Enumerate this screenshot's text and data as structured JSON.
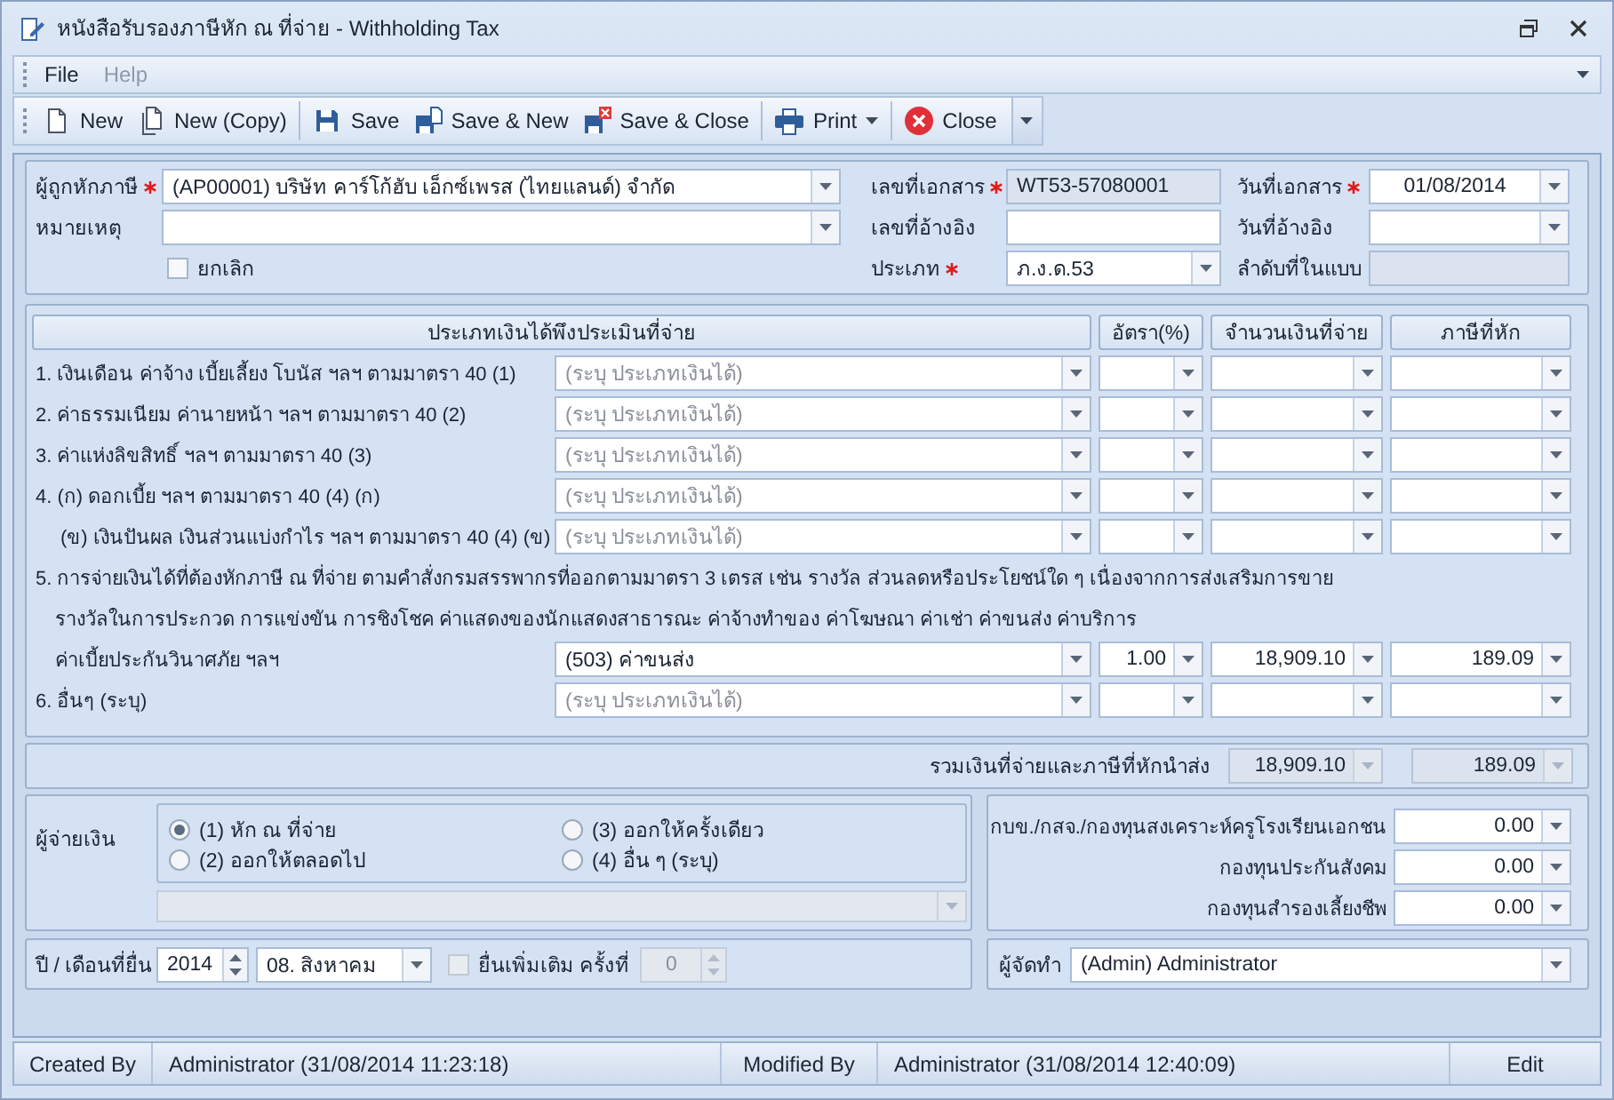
{
  "window": {
    "title": "หนังสือรับรองภาษีหัก ณ ที่จ่าย - Withholding Tax"
  },
  "menu": [
    {
      "label": "File",
      "disabled": false
    },
    {
      "label": "Help",
      "disabled": true
    }
  ],
  "toolbar": {
    "groups": [
      [
        {
          "label": "New",
          "has_menu": false
        },
        {
          "label": "New (Copy)",
          "has_menu": false
        }
      ],
      [
        {
          "label": "Save",
          "has_menu": false
        },
        {
          "label": "Save & New",
          "has_menu": false
        },
        {
          "label": "Save & Close",
          "has_menu": false
        }
      ],
      [
        {
          "label": "Print",
          "has_menu": true
        }
      ],
      [
        {
          "label": "Close",
          "has_menu": false
        }
      ]
    ]
  },
  "header": {
    "fields": [
      {
        "kind": "combo",
        "label": "ผู้ถูกหักภาษี",
        "required": true,
        "value": "(AP00001) บริษัท คาร์โก้ฮับ เอ็กซ์เพรส (ไทยแลนด์) จำกัด"
      },
      {
        "kind": "readonly",
        "label": "เลขที่เอกสาร",
        "required": true,
        "value": "WT53-57080001"
      },
      {
        "kind": "date",
        "label": "วันที่เอกสาร",
        "required": true,
        "value": "01/08/2014"
      },
      {
        "kind": "combo",
        "label": "หมายเหตุ",
        "required": false
      },
      {
        "kind": "input",
        "label": "เลขที่อ้างอิง",
        "required": false
      },
      {
        "kind": "date",
        "label": "วันที่อ้างอิง",
        "required": false
      },
      {
        "kind": "checkbox",
        "label": "ยกเลิก",
        "checked": false
      },
      {
        "kind": "combo",
        "label": "ประเภท",
        "required": true,
        "value": "ภ.ง.ด.53"
      },
      {
        "kind": "readonly",
        "label": "ลำดับที่ในแบบ",
        "required": false
      }
    ]
  },
  "income": {
    "columns": [
      "ประเภทเงินได้พึงประเมินที่จ่าย",
      "อัตรา(%)",
      "จำนวนเงินที่จ่าย",
      "ภาษีที่หัก"
    ],
    "rows": [
      {
        "lines": [
          "1. เงินเดือน ค่าจ้าง เบี้ยเลี้ยง โบนัส ฯลฯ ตามมาตรา 40 (1)"
        ],
        "type": {
          "placeholder": "(ระบุ ประเภทเงินได้)"
        }
      },
      {
        "lines": [
          "2. ค่าธรรมเนียม ค่านายหน้า ฯลฯ ตามมาตรา 40 (2)"
        ],
        "type": {
          "placeholder": "(ระบุ ประเภทเงินได้)"
        }
      },
      {
        "lines": [
          "3. ค่าแห่งลิขสิทธิ์ ฯลฯ ตามมาตรา 40 (3)"
        ],
        "type": {
          "placeholder": "(ระบุ ประเภทเงินได้)"
        }
      },
      {
        "lines": [
          "4. (ก) ดอกเบี้ย ฯลฯ ตามมาตรา 40 (4) (ก)"
        ],
        "type": {
          "placeholder": "(ระบุ ประเภทเงินได้)"
        },
        "children": [
          {
            "lines": [
              "(ข) เงินปันผล เงินส่วนแบ่งกำไร ฯลฯ ตามมาตรา 40 (4) (ข)"
            ],
            "type": {
              "placeholder": "(ระบุ ประเภทเงินได้)"
            }
          }
        ]
      },
      {
        "lines": [
          "5. การจ่ายเงินได้ที่ต้องหักภาษี ณ ที่จ่าย ตามคำสั่งกรมสรรพากรที่ออกตามมาตรา 3 เตรส เช่น รางวัล ส่วนลดหรือประโยชน์ใด ๆ เนื่องจากการส่งเสริมการขาย",
          "รางวัลในการประกวด การแข่งขัน การชิงโชค ค่าแสดงของนักแสดงสาธารณะ ค่าจ้างทำของ ค่าโฆษณา ค่าเช่า ค่าขนส่ง ค่าบริการ",
          "ค่าเบี้ยประกันวินาศภัย ฯลฯ"
        ],
        "type": {
          "value": "(503) ค่าขนส่ง"
        },
        "rate": "1.00",
        "amount": "18,909.10",
        "tax": "189.09"
      },
      {
        "lines": [
          "6. อื่นๆ (ระบุ)"
        ],
        "type": {
          "placeholder": "(ระบุ ประเภทเงินได้)"
        }
      }
    ]
  },
  "totals": {
    "label": "รวมเงินที่จ่ายและภาษีที่หักนำส่ง",
    "amount": "18,909.10",
    "tax": "189.09"
  },
  "payer": {
    "label": "ผู้จ่ายเงิน",
    "options": [
      {
        "label": "(1) หัก ณ ที่จ่าย",
        "selected": true
      },
      {
        "label": "(2) ออกให้ตลอดไป",
        "selected": false
      },
      {
        "label": "(3) ออกให้ครั้งเดียว",
        "selected": false
      },
      {
        "label": "(4) อื่น ๆ (ระบุ)",
        "selected": false
      }
    ],
    "other": {
      "disabled": true
    }
  },
  "funds": [
    {
      "label": "กบข./กสจ./กองทุนสงเคราะห์ครูโรงเรียนเอกชน",
      "value": "0.00"
    },
    {
      "label": "กองทุนประกันสังคม",
      "value": "0.00"
    },
    {
      "label": "กองทุนสำรองเลี้ยงชีพ",
      "value": "0.00"
    }
  ],
  "filing": {
    "label": "ปี / เดือนที่ยื่น",
    "year": "2014",
    "month": "08. สิงหาคม",
    "additional": {
      "label": "ยื่นเพิ่มเติม ครั้งที่",
      "checked": false,
      "disabled": true,
      "count": "0"
    }
  },
  "preparer": {
    "label": "ผู้จัดทำ",
    "value": "(Admin) Administrator"
  },
  "status_bar": {
    "fields": [
      {
        "label": "Created By",
        "value": "Administrator (31/08/2014 11:23:18)"
      },
      {
        "label": "Modified By",
        "value": "Administrator (31/08/2014 12:40:09)"
      }
    ],
    "mode": "Edit"
  }
}
